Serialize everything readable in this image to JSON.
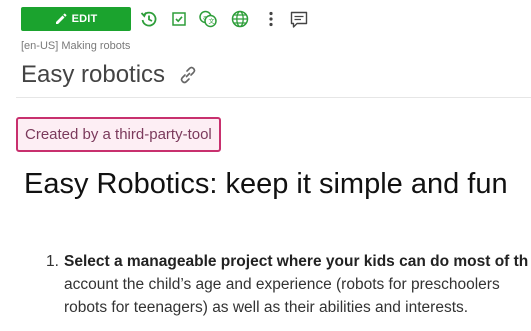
{
  "toolbar": {
    "edit_label": "EDIT",
    "icons": [
      "pencil-icon",
      "history-icon",
      "checklist-icon",
      "translate-icon",
      "globe-icon",
      "more-vertical-icon",
      "comment-icon"
    ]
  },
  "page": {
    "breadcrumb": "[en-US] Making robots",
    "title": "Easy robotics",
    "badge": "Created by a third-party-tool"
  },
  "content": {
    "heading": "Easy Robotics: keep it simple and fun",
    "list": [
      {
        "number": "1.",
        "bold": "Select a manageable project where your kids can do most of th",
        "lines": [
          "account the child’s age and experience (robots for preschoolers",
          "robots for teenagers) as well as their abilities and interests."
        ]
      }
    ]
  },
  "colors": {
    "edit_button": "#1ba32e",
    "icon_green": "#2e9e3a",
    "badge_border": "#c8306e",
    "badge_background": "#fdeef4"
  }
}
